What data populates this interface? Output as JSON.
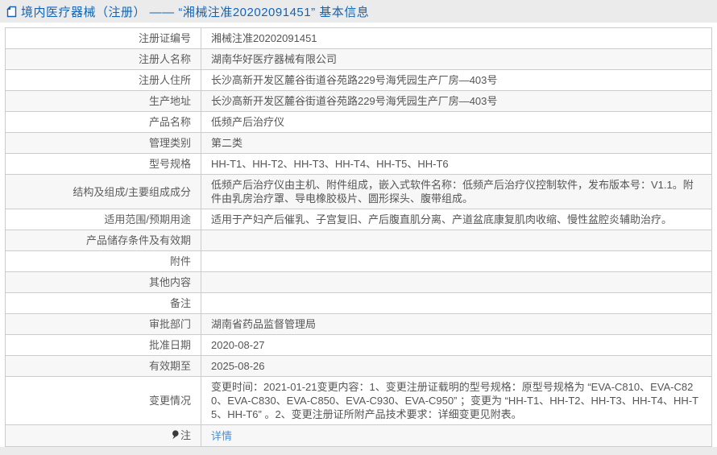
{
  "colors": {
    "accent_blue": "#1464b4",
    "link_blue": "#4a90d9",
    "border_gray": "#cccccc",
    "stripe_gray": "#f7f7f7",
    "band_gray": "#ebebeb"
  },
  "header": {
    "icon": "document-icon",
    "title": "境内医疗器械（注册） —— “湘械注准20202091451” 基本信息"
  },
  "table": {
    "rows": [
      {
        "label": "注册证编号",
        "value": "湘械注准20202091451"
      },
      {
        "label": "注册人名称",
        "value": "湖南华好医疗器械有限公司"
      },
      {
        "label": "注册人住所",
        "value": "长沙高新开发区麓谷街道谷苑路229号海凭园生产厂房—403号"
      },
      {
        "label": "生产地址",
        "value": "长沙高新开发区麓谷街道谷苑路229号海凭园生产厂房—403号"
      },
      {
        "label": "产品名称",
        "value": "低频产后治疗仪"
      },
      {
        "label": "管理类别",
        "value": "第二类"
      },
      {
        "label": "型号规格",
        "value": "HH-T1、HH-T2、HH-T3、HH-T4、HH-T5、HH-T6"
      },
      {
        "label": "结构及组成/主要组成成分",
        "value": "低频产后治疗仪由主机、附件组成，嵌入式软件名称：低频产后治疗仪控制软件，发布版本号：V1.1。附件由乳房治疗罩、导电橡胶极片、圆形探头、腹带组成。"
      },
      {
        "label": "适用范围/预期用途",
        "value": "适用于产妇产后催乳、子宫复旧、产后腹直肌分离、产道盆底康复肌肉收缩、慢性盆腔炎辅助治疗。"
      },
      {
        "label": "产品储存条件及有效期",
        "value": ""
      },
      {
        "label": "附件",
        "value": ""
      },
      {
        "label": "其他内容",
        "value": ""
      },
      {
        "label": "备注",
        "value": ""
      },
      {
        "label": "审批部门",
        "value": "湖南省药品监督管理局"
      },
      {
        "label": "批准日期",
        "value": "2020-08-27"
      },
      {
        "label": "有效期至",
        "value": "2025-08-26"
      },
      {
        "label": "变更情况",
        "value": "变更时间：2021-01-21变更内容：1、变更注册证载明的型号规格：原型号规格为 “EVA-C810、EVA-C820、EVA-C830、EVA-C850、EVA-C930、EVA-C950” ；变更为 “HH-T1、HH-T2、HH-T3、HH-T4、HH-T5、HH-T6” 。2、变更注册证所附产品技术要求：详细变更见附表。"
      },
      {
        "label": "注",
        "label_icon": "note-pin-icon",
        "value": "详情",
        "value_is_link": true
      }
    ]
  }
}
